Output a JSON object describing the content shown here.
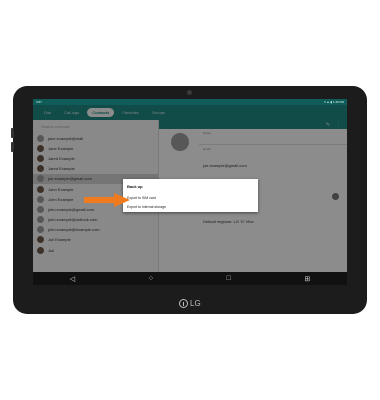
{
  "statusbar": {
    "left": "3:57",
    "right": "▾ ▲ ▮ 1:46 PM"
  },
  "appbar": {
    "tabs": [
      {
        "label": "Dial",
        "active": false
      },
      {
        "label": "Call logs",
        "active": false
      },
      {
        "label": "Contacts",
        "active": true
      },
      {
        "label": "Favorites",
        "active": false
      },
      {
        "label": "Groups",
        "active": false
      }
    ]
  },
  "search": {
    "placeholder": "Search contacts"
  },
  "contacts": [
    {
      "name": "jane.example@mail",
      "photo": false,
      "selected": false
    },
    {
      "name": "Jane Example",
      "photo": true,
      "selected": false
    },
    {
      "name": "Jared Example",
      "photo": true,
      "selected": false
    },
    {
      "name": "Jared Example",
      "photo": true,
      "selected": false
    },
    {
      "name": "joe.example@gmail.com",
      "photo": false,
      "selected": true
    },
    {
      "name": "John Example",
      "photo": true,
      "selected": false
    },
    {
      "name": "John Example",
      "photo": false,
      "selected": false
    },
    {
      "name": "john.example@gmail.com",
      "photo": false,
      "selected": false
    },
    {
      "name": "john.example@outlook.com",
      "photo": false,
      "selected": false
    },
    {
      "name": "john.example@example.com",
      "photo": false,
      "selected": false
    },
    {
      "name": "Juli Example",
      "photo": true,
      "selected": false
    },
    {
      "name": "Juli",
      "photo": true,
      "selected": false
    }
  ],
  "detail": {
    "header_icons": {
      "edit": "✎",
      "more": "⋮"
    },
    "fields": [
      {
        "label": "Name",
        "value": ""
      },
      {
        "label": "Email",
        "value": "joe.example@gmail.com"
      },
      {
        "label": "Phone",
        "value": ""
      },
      {
        "label": "Groups",
        "value": ""
      },
      {
        "label": "Note",
        "value": "Default ringtone: LG ‘G’ Vibe"
      }
    ]
  },
  "dialog": {
    "title": "Back up",
    "items": [
      "Export to SIM card",
      "Export to internal storage"
    ]
  },
  "navbar": {
    "back": "◁",
    "home": "○",
    "recents": "□",
    "extra": "⊞"
  },
  "brand": {
    "logo_text": "LG"
  },
  "colors": {
    "accent": "#1f8a85",
    "arrow": "#f07b1d"
  }
}
